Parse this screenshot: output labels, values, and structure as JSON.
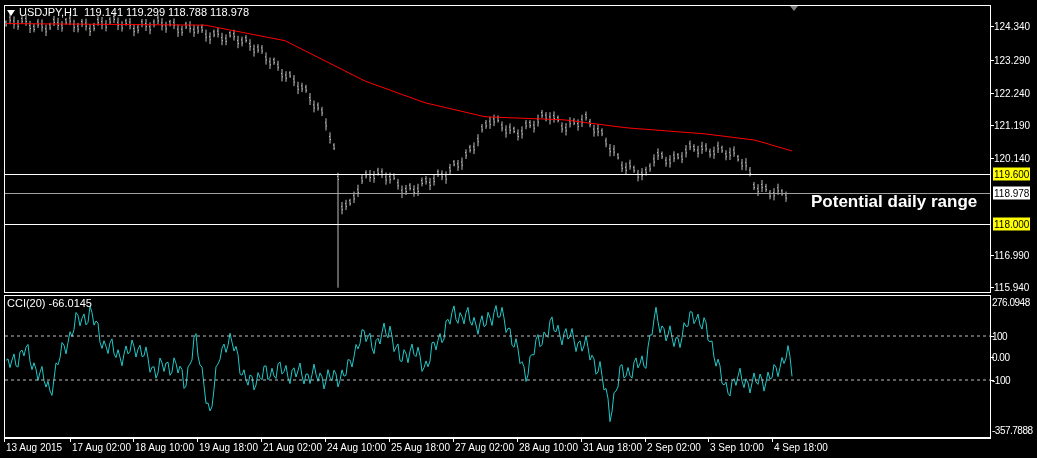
{
  "main_chart": {
    "symbol": "USDJPY,H1",
    "ohlc": "119.141 119.299 118.788 118.978",
    "price_axis": [
      {
        "label": "124.340",
        "kind": "tick"
      },
      {
        "label": "123.290",
        "kind": "tick"
      },
      {
        "label": "122.240",
        "kind": "tick"
      },
      {
        "label": "121.190",
        "kind": "tick"
      },
      {
        "label": "120.140",
        "kind": "tick"
      },
      {
        "label": "119.600",
        "kind": "level"
      },
      {
        "label": "118.978",
        "kind": "current"
      },
      {
        "label": "118.000",
        "kind": "level"
      },
      {
        "label": "116.990",
        "kind": "tick"
      },
      {
        "label": "115.940",
        "kind": "tick"
      }
    ],
    "annotation": "Potential daily range"
  },
  "indicator": {
    "title": "CCI(20) -66.0145",
    "axis": [
      {
        "label": "276.0948",
        "kind": "max"
      },
      {
        "label": "100",
        "kind": "level"
      },
      {
        "label": "0.00",
        "kind": "tick"
      },
      {
        "label": "-100",
        "kind": "level"
      },
      {
        "label": "-357.7888",
        "kind": "min"
      }
    ]
  },
  "time_axis": [
    "13 Aug 2015",
    "17 Aug 02:00",
    "18 Aug 10:00",
    "19 Aug 18:00",
    "21 Aug 02:00",
    "24 Aug 10:00",
    "25 Aug 18:00",
    "27 Aug 02:00",
    "28 Aug 10:00",
    "31 Aug 18:00",
    "2 Sep 02:00",
    "3 Sep 10:00",
    "4 Sep 18:00"
  ]
}
